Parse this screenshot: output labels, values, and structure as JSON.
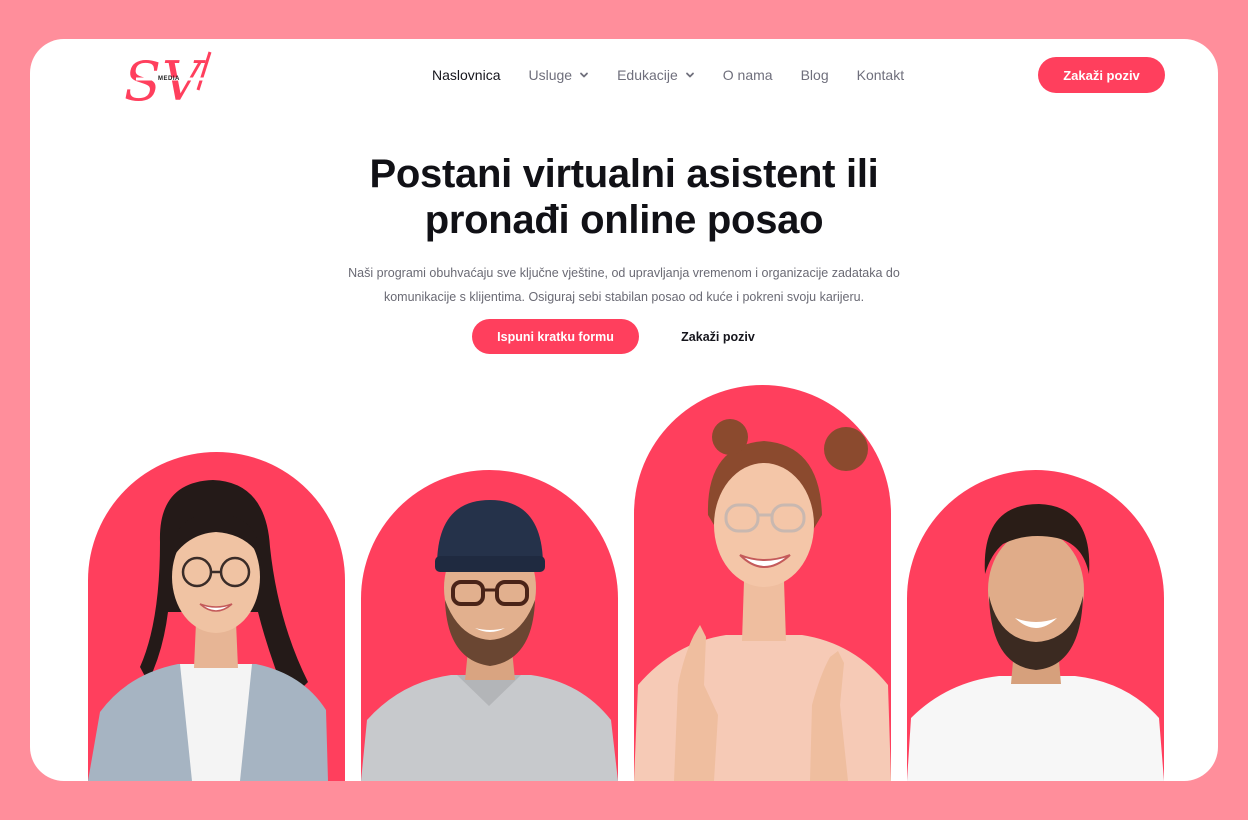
{
  "brand": {
    "logo_letters": "SV",
    "logo_sub": "MEDIA",
    "accent": "#ff3f5d",
    "frame_color": "#ff8e9b"
  },
  "nav": {
    "items": [
      {
        "label": "Naslovnica",
        "active": true,
        "dropdown": false
      },
      {
        "label": "Usluge",
        "active": false,
        "dropdown": true
      },
      {
        "label": "Edukacije",
        "active": false,
        "dropdown": true
      },
      {
        "label": "O nama",
        "active": false,
        "dropdown": false
      },
      {
        "label": "Blog",
        "active": false,
        "dropdown": false
      },
      {
        "label": "Kontakt",
        "active": false,
        "dropdown": false
      }
    ],
    "dropdown_icon": "chevron-down-icon",
    "cta_label": "Zakaži poziv"
  },
  "hero": {
    "title_line1": "Postani virtualni asistent ili",
    "title_line2": "pronađi online posao",
    "description_line1": "Naši programi obuhvaćaju sve ključne vještine, od upravljanja vremenom i organizacije zadataka do",
    "description_line2": "komunikacije s klijentima. Osiguraj sebi stabilan posao od kuće i pokreni svoju karijeru.",
    "primary_cta": "Ispuni kratku formu",
    "secondary_cta": "Zakaži poziv"
  },
  "people": [
    {
      "name": "woman-glasses-photo"
    },
    {
      "name": "man-beanie-photo"
    },
    {
      "name": "woman-smiling-photo"
    },
    {
      "name": "man-beard-photo"
    }
  ]
}
